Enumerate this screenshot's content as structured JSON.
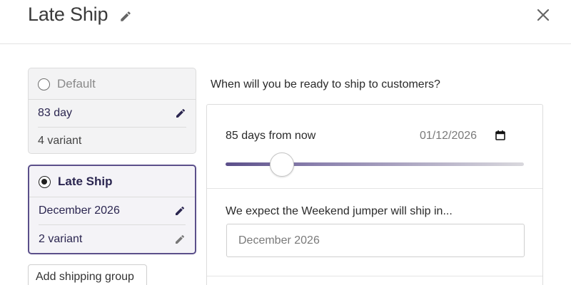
{
  "header": {
    "title": "Late Ship",
    "edit_icon": "pencil-icon",
    "close_icon": "close-icon"
  },
  "shipping_groups": [
    {
      "title": "Default",
      "selected": false,
      "rows": [
        {
          "text": "83 day",
          "icon": "pencil-icon"
        },
        {
          "text": "4 variant",
          "icon": null
        }
      ]
    },
    {
      "title": "Late Ship",
      "selected": true,
      "rows": [
        {
          "text": "December 2026",
          "icon": "pencil-icon"
        },
        {
          "text": "2 variant",
          "icon": "pencil-icon"
        }
      ]
    }
  ],
  "add_button_label": "Add shipping group",
  "main": {
    "question": "When will you be ready to ship to customers?",
    "days_label": "85 days from now",
    "date_value": "01/12/2026",
    "calendar_icon": "calendar-icon",
    "slider_level": 0.19,
    "expect_label": "We expect the Weekend jumper will ship in...",
    "ship_input_value": "",
    "ship_input_placeholder": "December 2026"
  },
  "colors": {
    "accent": "#5b4f8a",
    "selected_text": "#2b2650",
    "border": "#dcdcdc"
  }
}
